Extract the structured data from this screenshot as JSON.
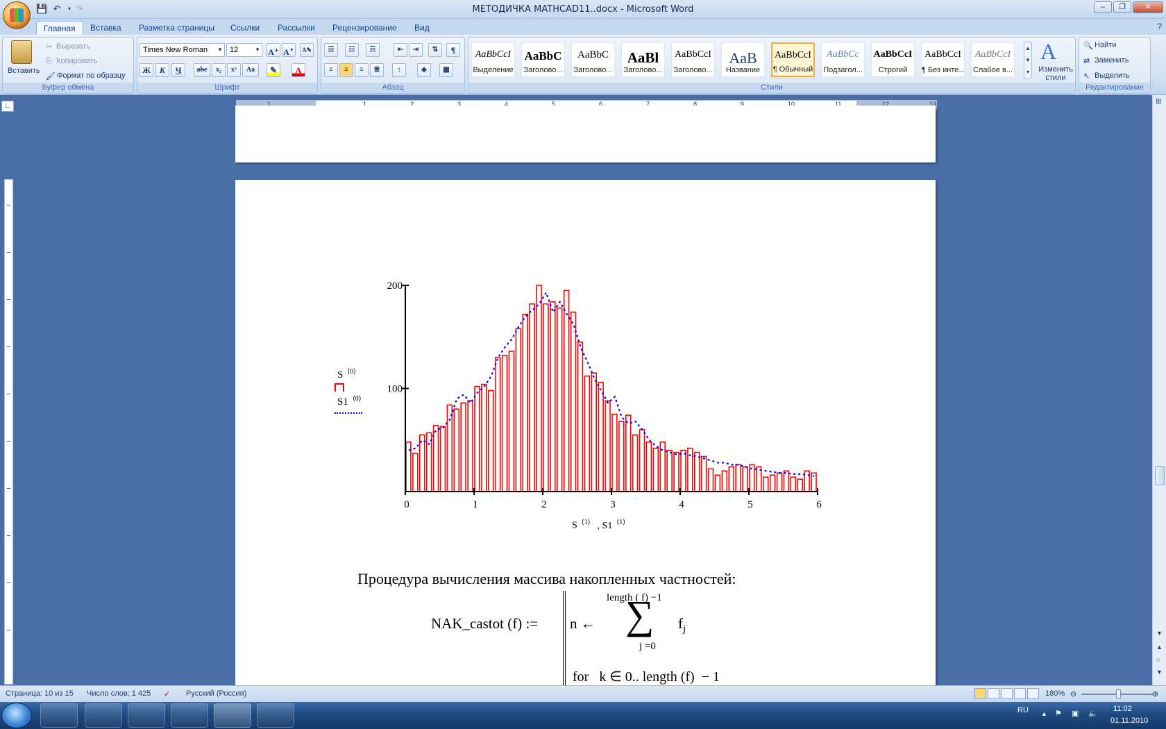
{
  "window": {
    "title": "МЕТОДИЧКА MATHCAD11..docx - Microsoft Word"
  },
  "tabs": [
    "Главная",
    "Вставка",
    "Разметка страницы",
    "Ссылки",
    "Рассылки",
    "Рецензирование",
    "Вид"
  ],
  "clipboard": {
    "paste": "Вставить",
    "cut": "Вырезать",
    "copy": "Копировать",
    "format_painter": "Формат по образцу",
    "group": "Буфер обмена"
  },
  "font": {
    "name": "Times New Roman",
    "size": "12",
    "group": "Шрифт",
    "bold": "Ж",
    "italic": "К",
    "underline": "Ч",
    "strike": "abc",
    "sub": "x₂",
    "sup": "x²",
    "case": "Aa"
  },
  "paragraph": {
    "group": "Абзац"
  },
  "styles": {
    "group": "Стили",
    "change": "Изменить стили",
    "items": [
      {
        "sample": "AaBbCcI",
        "name": "Выделение"
      },
      {
        "sample": "AaBbC",
        "name": "Заголово..."
      },
      {
        "sample": "AaBbC",
        "name": "Заголово..."
      },
      {
        "sample": "AaBl",
        "name": "Заголово..."
      },
      {
        "sample": "AaBbCcI",
        "name": "Заголово..."
      },
      {
        "sample": "AaB",
        "name": "Название"
      },
      {
        "sample": "AaBbCcI",
        "name": "¶ Обычный"
      },
      {
        "sample": "AaBbCc",
        "name": "Подзагол..."
      },
      {
        "sample": "AaBbCcI",
        "name": "Строгий"
      },
      {
        "sample": "AaBbCcI",
        "name": "¶ Без инте..."
      },
      {
        "sample": "AaBbCcI",
        "name": "Слабое в..."
      }
    ]
  },
  "editing": {
    "find": "Найти",
    "replace": "Заменить",
    "select": "Выделить",
    "group": "Редактирование"
  },
  "ruler_numbers": [
    "1",
    "1",
    "2",
    "3",
    "4",
    "5",
    "6",
    "7",
    "8",
    "9",
    "10",
    "11",
    "12",
    "13"
  ],
  "document": {
    "legend_s": "S",
    "legend_s1": "S1",
    "legend_sup": "⟨0⟩",
    "xlabel_s": "S",
    "xlabel_s1": ", S1",
    "xlabel_sup": "⟨1⟩",
    "procedure_text": "Процедура вычисления массива накопленных частностей:",
    "func_def": "NAK_castot (f) :=",
    "assign": "n ←",
    "sum_upper": "length ( f) −1",
    "sum_lower": "j  =0",
    "summand": "f",
    "summand_sub": "j",
    "for_line": "for   k ∈ 0.. length (f)  − 1"
  },
  "chart_data": {
    "type": "bar",
    "xlim": [
      0,
      6
    ],
    "ylim": [
      0,
      200
    ],
    "x_ticks": [
      0,
      1,
      2,
      3,
      4,
      5,
      6
    ],
    "y_ticks": [
      100,
      200
    ],
    "series": [
      {
        "name": "S⟨0⟩",
        "style": "bar",
        "color": "#ff0000",
        "x": [
          0,
          0.1,
          0.2,
          0.3,
          0.4,
          0.5,
          0.6,
          0.7,
          0.8,
          0.9,
          1.0,
          1.1,
          1.2,
          1.3,
          1.4,
          1.5,
          1.6,
          1.7,
          1.8,
          1.9,
          2.0,
          2.1,
          2.2,
          2.3,
          2.4,
          2.5,
          2.6,
          2.7,
          2.8,
          2.9,
          3.0,
          3.1,
          3.2,
          3.3,
          3.4,
          3.5,
          3.6,
          3.7,
          3.8,
          3.9,
          4.0,
          4.1,
          4.2,
          4.3,
          4.4,
          4.5,
          4.6,
          4.7,
          4.8,
          4.9,
          5.0,
          5.1,
          5.2,
          5.3,
          5.4,
          5.5,
          5.6,
          5.7,
          5.8,
          5.9
        ],
        "y": [
          48,
          37,
          55,
          57,
          64,
          63,
          84,
          80,
          86,
          88,
          102,
          104,
          98,
          130,
          132,
          136,
          158,
          172,
          182,
          200,
          182,
          184,
          178,
          195,
          174,
          145,
          112,
          115,
          106,
          88,
          75,
          68,
          74,
          55,
          60,
          48,
          42,
          48,
          40,
          38,
          40,
          42,
          38,
          34,
          22,
          16,
          20,
          24,
          26,
          24,
          26,
          24,
          14,
          16,
          18,
          20,
          14,
          12,
          20,
          18
        ]
      },
      {
        "name": "S1⟨0⟩",
        "style": "dotted-line",
        "color": "#0000ff",
        "x": [
          0,
          0.1,
          0.2,
          0.3,
          0.4,
          0.5,
          0.6,
          0.7,
          0.8,
          0.9,
          1.0,
          1.1,
          1.2,
          1.3,
          1.4,
          1.5,
          1.6,
          1.7,
          1.8,
          1.9,
          2.0,
          2.1,
          2.2,
          2.3,
          2.4,
          2.5,
          2.6,
          2.7,
          2.8,
          2.9,
          3.0,
          3.1,
          3.2,
          3.3,
          3.4,
          3.5,
          3.6,
          3.7,
          3.8,
          3.9,
          4.0,
          4.1,
          4.2,
          4.3,
          4.4,
          4.5,
          4.6,
          4.7,
          4.8,
          4.9,
          5.0,
          5.1,
          5.2,
          5.3,
          5.4,
          5.5,
          5.6,
          5.7,
          5.8,
          5.9
        ],
        "y": [
          40,
          42,
          50,
          46,
          60,
          62,
          70,
          90,
          94,
          86,
          96,
          102,
          112,
          130,
          140,
          148,
          160,
          170,
          176,
          182,
          193,
          174,
          184,
          172,
          162,
          140,
          126,
          110,
          98,
          86,
          92,
          72,
          66,
          68,
          60,
          50,
          44,
          40,
          38,
          36,
          37,
          35,
          34,
          32,
          30,
          28,
          28,
          26,
          26,
          24,
          22,
          21,
          20,
          19,
          18,
          18,
          17,
          17,
          16,
          15
        ]
      }
    ]
  },
  "status": {
    "page": "Страница: 10 из 15",
    "words": "Число слов: 1 425",
    "lang": "Русский (Россия)",
    "zoom": "180%"
  },
  "tray": {
    "lang": "RU",
    "time": "11:02",
    "date": "01.11.2010"
  }
}
